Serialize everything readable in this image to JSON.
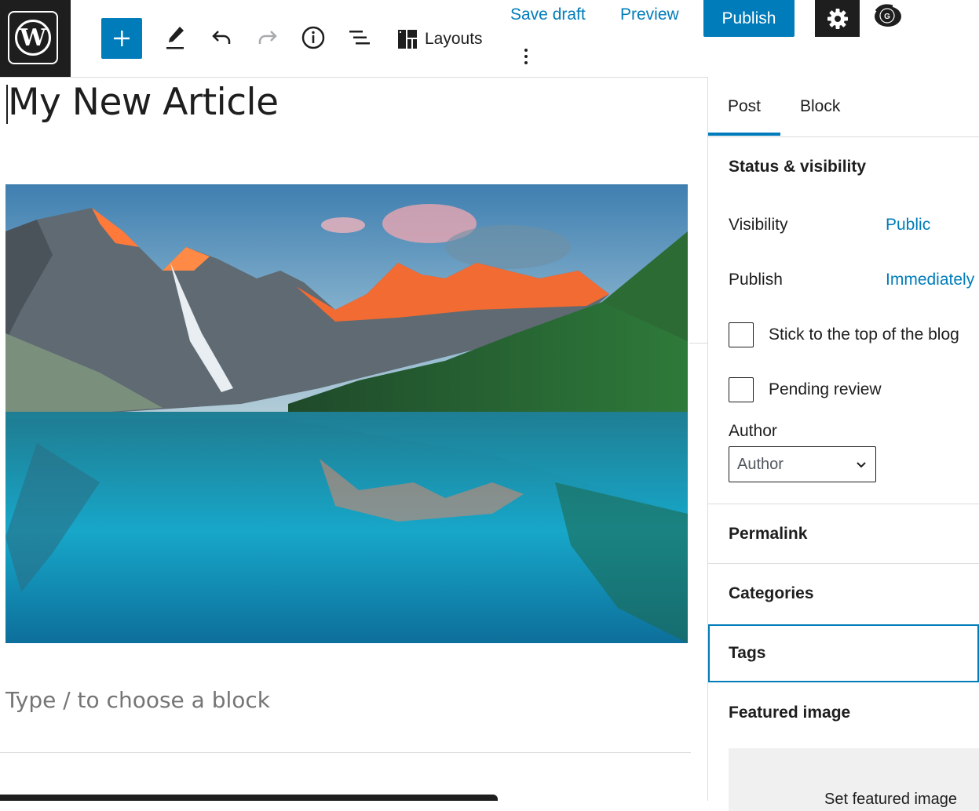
{
  "toolbar": {
    "layouts_label": "Layouts",
    "save_draft_label": "Save draft",
    "preview_label": "Preview",
    "publish_label": "Publish",
    "grammarly_letter": "G"
  },
  "icons": {
    "logo": "wordpress-logo",
    "add": "plus-icon",
    "edit": "pencil-icon",
    "undo": "undo-icon",
    "redo": "redo-icon",
    "info": "info-icon",
    "outline": "list-view-icon",
    "layouts": "layouts-icon",
    "settings": "gear-icon",
    "more": "more-vertical-icon",
    "grammarly": "grammarly-icon",
    "dropdown": "chevron-down-icon"
  },
  "colors": {
    "accent": "#007cba",
    "dark": "#1e1e1e",
    "placeholder": "#757575"
  },
  "editor": {
    "title": "My New Article",
    "block_placeholder": "Type / to choose a block",
    "image": "Mountain lake landscape photo"
  },
  "sidebar": {
    "tabs": [
      "Post",
      "Block"
    ],
    "active_tab": "Post",
    "status_panel": {
      "title": "Status & visibility",
      "visibility_label": "Visibility",
      "visibility_value": "Public",
      "publish_label": "Publish",
      "publish_value": "Immediately",
      "sticky_label": "Stick to the top of the blog",
      "pending_label": "Pending review",
      "author_label": "Author",
      "author_value": "Author"
    },
    "panels": {
      "permalink": "Permalink",
      "categories": "Categories",
      "tags": "Tags",
      "featured_image": "Featured image",
      "featured_image_button": "Set featured image"
    }
  }
}
